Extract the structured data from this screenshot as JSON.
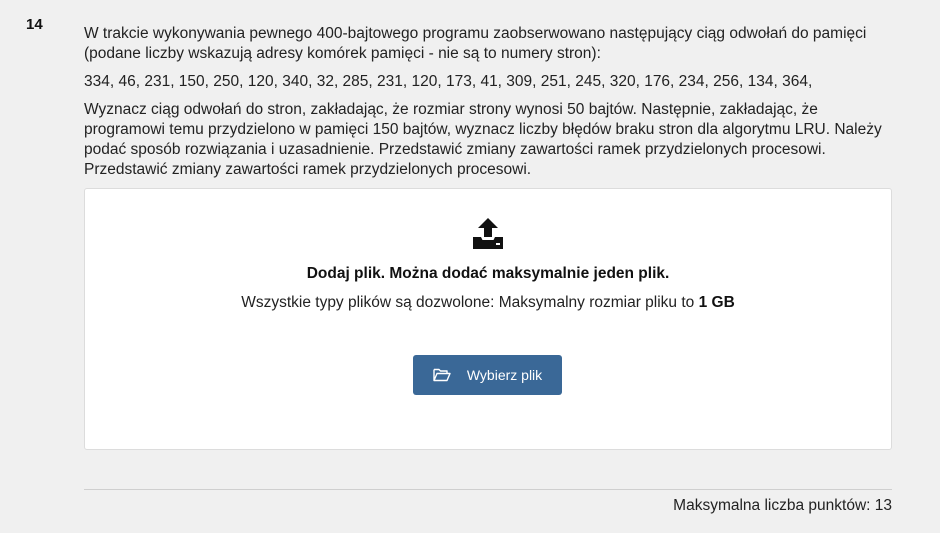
{
  "question": {
    "number": "14",
    "paragraph1": "W trakcie wykonywania pewnego 400-bajtowego programu zaobserwowano następujący ciąg odwołań do pamięci (podane liczby wskazują adresy komórek pamięci - nie są to numery stron):",
    "addresses": "334, 46, 231, 150, 250, 120, 340, 32, 285, 231, 120, 173, 41, 309, 251, 245, 320, 176, 234, 256, 134, 364,",
    "paragraph3": "Wyznacz ciąg odwołań do stron, zakładając, że rozmiar strony wynosi 50 bajtów. Następnie, zakładając, że programowi temu przydzielono w pamięci 150 bajtów, wyznacz liczby błędów braku stron dla algorytmu LRU. Należy podać sposób rozwiązania i uzasadnienie. Przedstawić zmiany zawartości ramek przydzielonych procesowi. Przedstawić zmiany zawartości ramek przydzielonych procesowi."
  },
  "upload": {
    "icon": "upload-icon",
    "title": "Dodaj plik. Można dodać maksymalnie jeden plik.",
    "info_prefix": "Wszystkie typy plików są dozwolone: Maksymalny rozmiar pliku to ",
    "info_size": "1 GB",
    "button_label": "Wybierz plik",
    "button_icon": "folder-open-icon",
    "button_color": "#3a6897"
  },
  "footer": {
    "max_points": "Maksymalna liczba punktów: 13"
  }
}
